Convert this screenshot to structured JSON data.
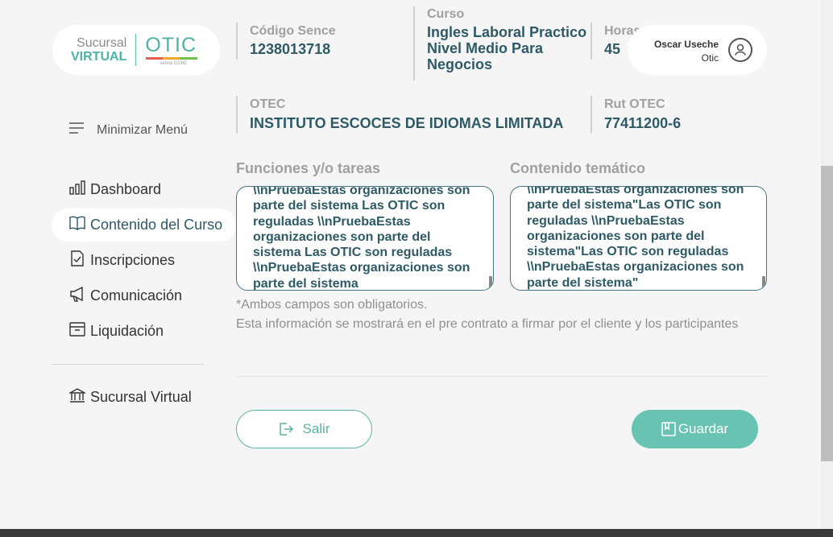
{
  "logo": {
    "line1": "Sucursal",
    "line2": "VIRTUAL",
    "brand": "OTIC",
    "sub": "sence CChC"
  },
  "course": {
    "codigo_label": "Código Sence",
    "codigo_value": "1238013718",
    "curso_label": "Curso",
    "curso_value": "Ingles Laboral Practico Nivel Medio Para Negocios",
    "horas_label": "Horas",
    "horas_value": "45",
    "otec_label": "OTEC",
    "otec_value": "INSTITUTO ESCOCES DE IDIOMAS LIMITADA",
    "rut_label": "Rut OTEC",
    "rut_value": "77411200-6"
  },
  "user": {
    "name": "Oscar Useche",
    "role": "Otic",
    "icon": "user-circle-icon"
  },
  "sidebar": {
    "toggle_label": "Minimizar Menú",
    "items": [
      {
        "label": "Dashboard",
        "icon": "bar-chart-icon"
      },
      {
        "label": "Contenido del Curso",
        "icon": "book-icon",
        "active": true
      },
      {
        "label": "Inscripciones",
        "icon": "document-check-icon"
      },
      {
        "label": "Comunicación",
        "icon": "megaphone-icon"
      },
      {
        "label": "Liquidación",
        "icon": "archive-box-icon"
      }
    ],
    "footer_item": {
      "label": "Sucursal Virtual",
      "icon": "bank-icon"
    }
  },
  "form": {
    "funciones_label": "Funciones y/o tareas",
    "funciones_value": "\\\\nPruebaEstas organizaciones son parte del sistema Las OTIC son reguladas \\\\nPruebaEstas organizaciones son parte del sistema Las OTIC son reguladas \\\\nPruebaEstas organizaciones son parte del sistema",
    "contenido_label": "Contenido temático",
    "contenido_value": "\\\\nPruebaEstas organizaciones son parte del sistema\"Las OTIC son reguladas \\\\nPruebaEstas organizaciones son parte del sistema\"Las OTIC son reguladas \\\\nPruebaEstas organizaciones son parte del sistema\"",
    "note1": "*Ambos campos son obligatorios.",
    "note2": "Esta información se mostrará en el pre contrato a firmar por el cliente y los participantes"
  },
  "actions": {
    "salir_label": "Salir",
    "guardar_label": "Guardar"
  },
  "colors": {
    "accent": "#68c3b2",
    "text_dark": "#2e5a66"
  }
}
